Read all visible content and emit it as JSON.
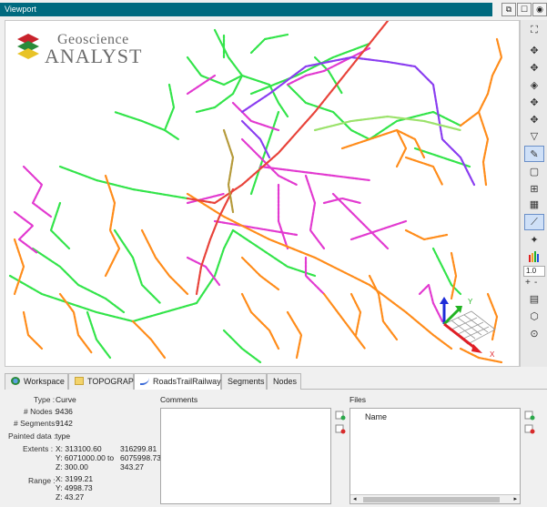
{
  "window": {
    "title": "Viewport"
  },
  "title_buttons": [
    {
      "glyph": "⧉",
      "name": "restore-button"
    },
    {
      "glyph": "☐",
      "name": "maximize-button"
    },
    {
      "glyph": "◉",
      "name": "visibility-toggle-button"
    }
  ],
  "logo": {
    "line1": "Geoscience",
    "line2": "ANALYST"
  },
  "axis_triad": {
    "y": "Y",
    "x": "X"
  },
  "toolbar": {
    "zoom_value": "1.0",
    "plus": "+",
    "minus": "-",
    "tools": [
      {
        "glyph": "⛶",
        "name": "zoom-extents-icon"
      },
      {
        "glyph": "✥",
        "name": "view-top-icon"
      },
      {
        "glyph": "✥",
        "name": "view-bottom-icon"
      },
      {
        "glyph": "◈",
        "name": "view-front-icon"
      },
      {
        "glyph": "✥",
        "name": "view-back-icon"
      },
      {
        "glyph": "✥",
        "name": "view-side-icon"
      },
      {
        "glyph": "▽",
        "name": "view-iso-icon"
      },
      {
        "glyph": "✎",
        "name": "paint-tool-icon"
      },
      {
        "glyph": "▢",
        "name": "select-tool-icon"
      },
      {
        "glyph": "⊞",
        "name": "grid-tool-icon"
      },
      {
        "glyph": "▦",
        "name": "clip-tool-icon"
      },
      {
        "glyph": "⟋",
        "name": "axis-toggle-icon"
      },
      {
        "glyph": "✦",
        "name": "lighting-icon"
      },
      {
        "glyph": "▮",
        "name": "colorbar-icon"
      },
      {
        "glyph": "▤",
        "name": "legend-icon"
      },
      {
        "glyph": "⬡",
        "name": "cube-icon"
      },
      {
        "glyph": "⊙",
        "name": "magnet-icon"
      }
    ]
  },
  "tabs": [
    {
      "label": "Workspace",
      "name": "tab-workspace"
    },
    {
      "label": "TOPOGRAPHY",
      "name": "tab-topography"
    },
    {
      "label": "RoadsTrailRailways",
      "name": "tab-roadstrailrailways"
    },
    {
      "label": "Segments",
      "name": "tab-segments"
    },
    {
      "label": "Nodes",
      "name": "tab-nodes"
    }
  ],
  "properties": {
    "type_label": "Type :",
    "type_value": "Curve",
    "nodes_label": "# Nodes :",
    "nodes_value": "9436",
    "segments_label": "# Segments :",
    "segments_value": "9142",
    "painted_label": "Painted data :",
    "painted_value": "type",
    "extents_label": "Extents :",
    "extents_x_min": "X: 313100.60",
    "extents_x_max": "316299.81",
    "extents_y_min": "Y: 6071000.00",
    "extents_to": "to",
    "extents_y_max": "6075998.73",
    "extents_z_min": "Z: 300.00",
    "extents_z_max": "343.27",
    "range_label": "Range :",
    "range_x": "X: 3199.21",
    "range_y": "Y: 4998.73",
    "range_z": "Z: 43.27"
  },
  "comments": {
    "title": "Comments"
  },
  "files": {
    "title": "Files",
    "column_name": "Name"
  }
}
